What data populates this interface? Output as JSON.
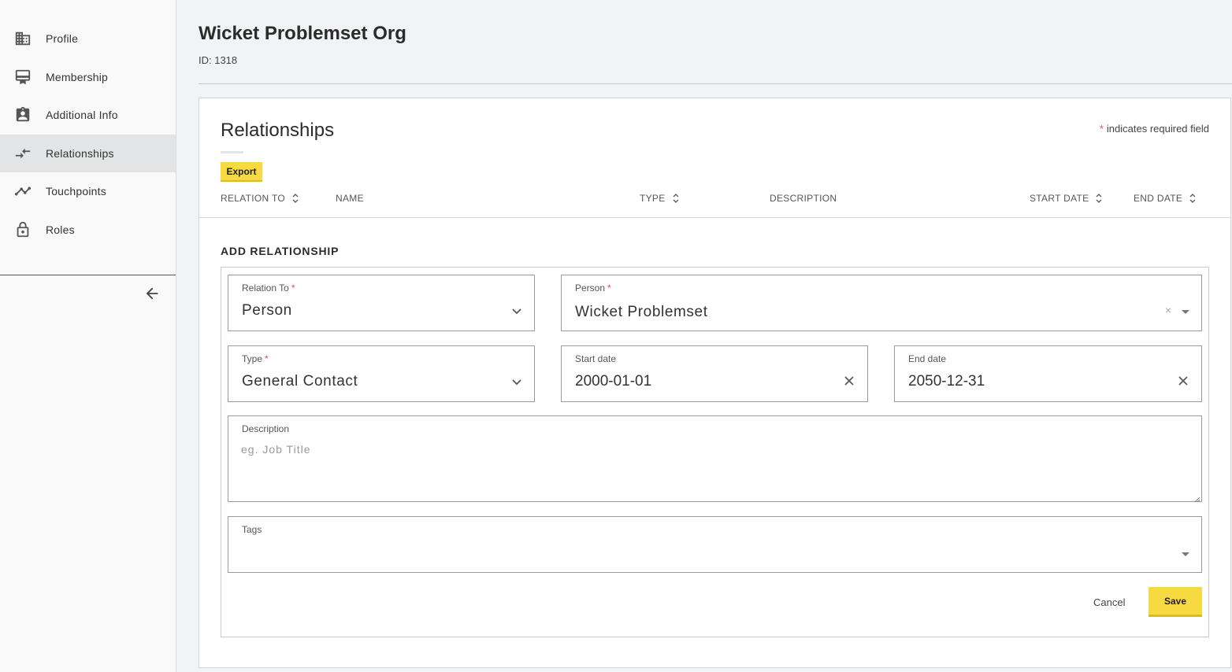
{
  "sidebar": {
    "items": [
      {
        "label": "Profile",
        "icon": "building-icon"
      },
      {
        "label": "Membership",
        "icon": "membership-card-icon"
      },
      {
        "label": "Additional Info",
        "icon": "contact-badge-icon"
      },
      {
        "label": "Relationships",
        "icon": "compare-arrows-icon",
        "active": true
      },
      {
        "label": "Touchpoints",
        "icon": "trend-line-icon"
      },
      {
        "label": "Roles",
        "icon": "lock-icon"
      }
    ],
    "collapse_icon": "arrow-left-icon"
  },
  "header": {
    "title": "Wicket Problemset Org",
    "id_text": "ID: 1318"
  },
  "relationships": {
    "title": "Relationships",
    "required_note": "indicates required field",
    "required_star": "*",
    "export_label": "Export",
    "columns": [
      "RELATION TO",
      "NAME",
      "TYPE",
      "DESCRIPTION",
      "START DATE",
      "END DATE"
    ]
  },
  "add_relationship": {
    "title": "ADD RELATIONSHIP",
    "relation_to": {
      "label": "Relation To",
      "value": "Person"
    },
    "person": {
      "label": "Person",
      "value": "Wicket Problemset",
      "clear": "×"
    },
    "type": {
      "label": "Type",
      "value": "General Contact"
    },
    "start_date": {
      "label": "Start date",
      "value": "2000-01-01"
    },
    "end_date": {
      "label": "End date",
      "value": "2050-12-31"
    },
    "description": {
      "label": "Description",
      "placeholder": "eg. Job Title"
    },
    "tags": {
      "label": "Tags"
    },
    "cancel_label": "Cancel",
    "save_label": "Save"
  },
  "colors": {
    "accent_yellow": "#f7d941",
    "required_red": "#d9534f",
    "active_nav_bg": "#e3e4e5"
  }
}
